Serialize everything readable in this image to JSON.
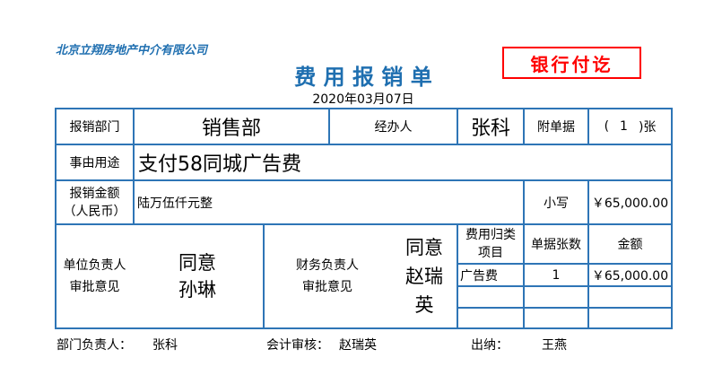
{
  "company": "北京立翔房地产中介有限公司",
  "stamp": "银行付讫",
  "title": "费 用 报 销 单",
  "date": "2020年03月07日",
  "row1": {
    "dept_label": "报销部门",
    "dept": "销售部",
    "handler_label": "经办人",
    "handler": "张科",
    "attach_label": "附单据",
    "attach_open": "(",
    "attach_count": "1",
    "attach_close": ")张"
  },
  "row2": {
    "purpose_label": "事由用途",
    "purpose": "支付58同城广告费"
  },
  "row3": {
    "amount_label_1": "报销金额",
    "amount_label_2": "（人民币）",
    "amount_words": "陆万伍仟元整",
    "small_label": "小写",
    "amount": "￥65,000.00"
  },
  "approval": {
    "unit_label_1": "单位负责人",
    "unit_label_2": "审批意见",
    "unit_opinion_1": "同意",
    "unit_opinion_2": "孙琳",
    "fin_label_1": "财务负责人",
    "fin_label_2": "审批意见",
    "fin_opinion_1": "同意",
    "fin_opinion_2": "赵瑞",
    "fin_opinion_3": "英"
  },
  "items": {
    "headers": [
      "费用归类项目",
      "单据张数",
      "金额"
    ],
    "rows": [
      [
        "广告费",
        "1",
        "￥65,000.00"
      ],
      [
        "",
        "",
        ""
      ],
      [
        "",
        "",
        ""
      ]
    ]
  },
  "footer": {
    "dept_head_label": "部门负责人：",
    "dept_head": "张科",
    "audit_label": "会计审核：",
    "audit": "赵瑞英",
    "cashier_label": "出纳：",
    "cashier": "王燕"
  }
}
